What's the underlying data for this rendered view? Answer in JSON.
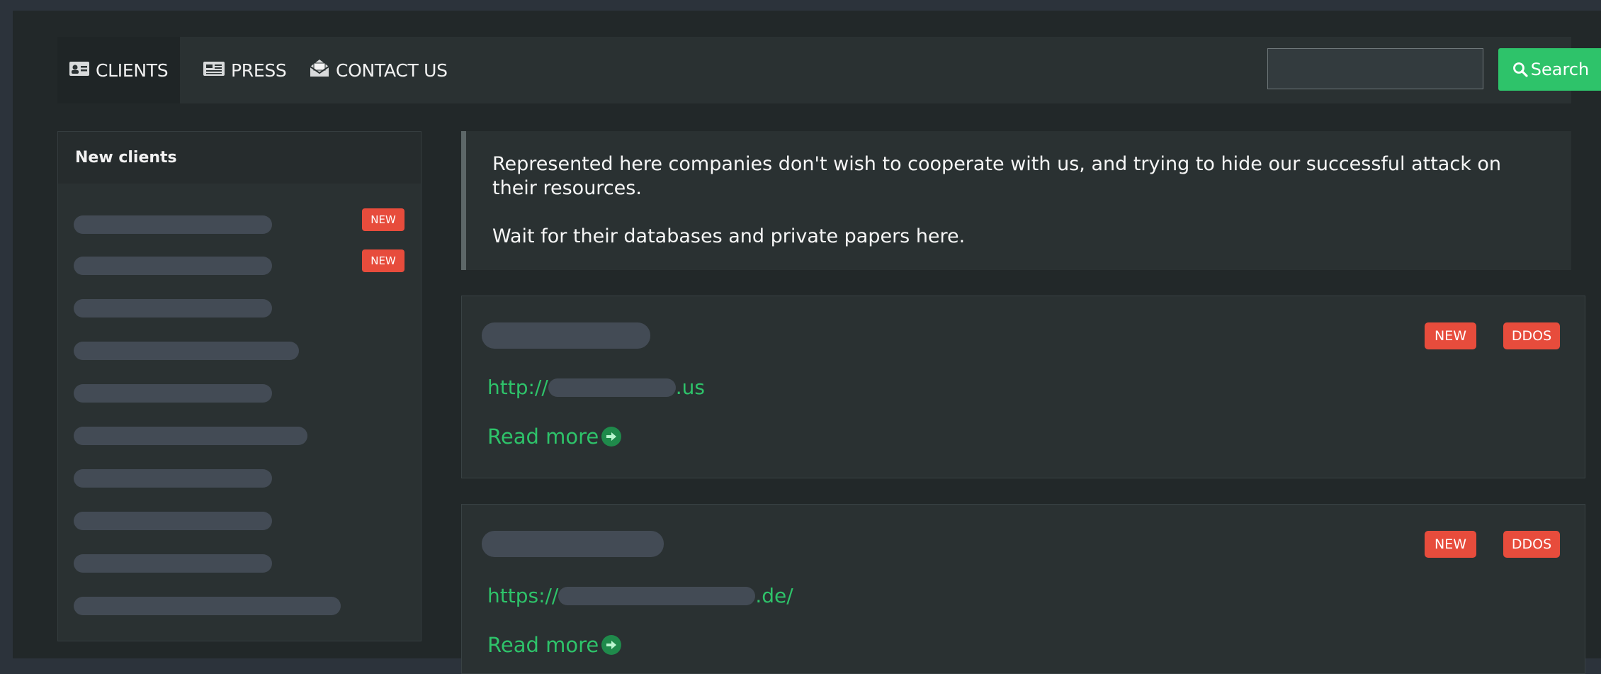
{
  "nav": {
    "items": [
      {
        "label": "CLIENTS",
        "icon": "id-card-icon",
        "active": true
      },
      {
        "label": "PRESS",
        "icon": "newspaper-icon",
        "active": false
      },
      {
        "label": "CONTACT US",
        "icon": "envelope-open-icon",
        "active": false
      }
    ],
    "search": {
      "placeholder": "",
      "value": "",
      "button_label": "Search"
    }
  },
  "sidebar": {
    "title": "New clients",
    "badge_label": "NEW"
  },
  "info": {
    "line1": "Represented here companies don't wish to cooperate with us, and trying to hide our successful attack on their resources.",
    "line2": "Wait for their databases and private papers here."
  },
  "cards": [
    {
      "url_prefix": "http://",
      "url_suffix": ".us",
      "badges": [
        "NEW",
        "DDOS"
      ],
      "read_more": "Read more"
    },
    {
      "url_prefix": "https://",
      "url_suffix": ".de/",
      "badges": [
        "NEW",
        "DDOS"
      ],
      "read_more": "Read more"
    }
  ],
  "colors": {
    "accent": "#2ec36a",
    "badge": "#e74c3c",
    "background": "#222829",
    "panel": "#2a3132"
  }
}
